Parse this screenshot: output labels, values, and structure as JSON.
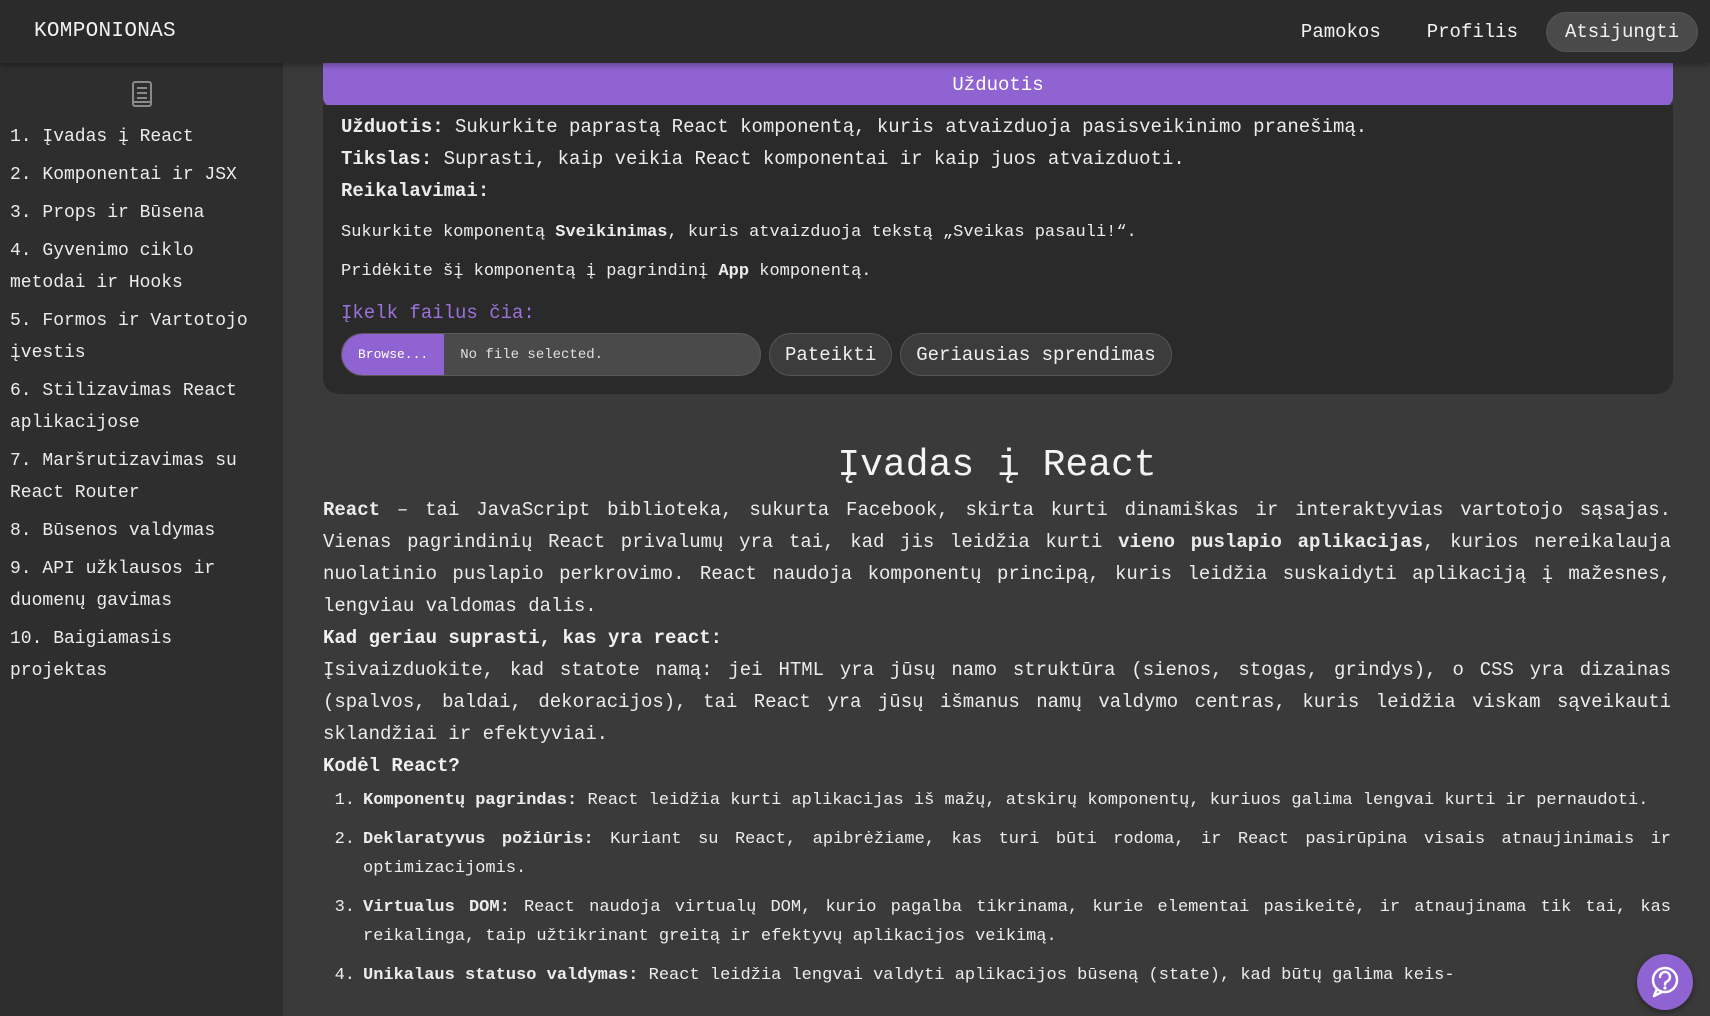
{
  "app": {
    "brand": "KOMPONIONAS",
    "nav": {
      "lessons": "Pamokos",
      "profile": "Profilis",
      "logout": "Atsijungti"
    }
  },
  "sidebar": {
    "icon": "book-icon",
    "items": [
      {
        "label": "1. Įvadas į React"
      },
      {
        "label": "2. Komponentai ir JSX"
      },
      {
        "label": "3. Props ir Būsena"
      },
      {
        "label": "4. Gyvenimo ciklo metodai ir Hooks"
      },
      {
        "label": "5. Formos ir Vartotojo įvestis"
      },
      {
        "label": "6. Stilizavimas React aplikacijose"
      },
      {
        "label": "7. Maršrutizavimas su React Router"
      },
      {
        "label": "8. Būsenos valdymas"
      },
      {
        "label": "9. API užklausos ir duomenų gavimas"
      },
      {
        "label": "10. Baigiamasis projektas"
      }
    ]
  },
  "task": {
    "header": "Užduotis",
    "task_label": "Užduotis:",
    "task_text": " Sukurkite paprastą React komponentą, kuris atvaizduoja pasisveikinimo pranešimą.",
    "goal_label": "Tikslas:",
    "goal_text": " Suprasti, kaip veikia React komponentai ir kaip juos atvaizduoti.",
    "requirements_label": "Reikalavimai:",
    "req1_a": "Sukurkite komponentą ",
    "req1_b": "Sveikinimas",
    "req1_c": ", kuris atvaizduoja tekstą „Sveikas pasauli!“.",
    "req2_a": "Pridėkite šį komponentą į pagrindinį ",
    "req2_b": "App",
    "req2_c": " komponentą.",
    "upload_label": "Įkelk failus čia:",
    "browse_label": "Browse...",
    "file_status": "No file selected.",
    "submit_label": "Pateikti",
    "best_solution_label": "Geriausias sprendimas"
  },
  "lesson": {
    "title": "Įvadas į React",
    "intro_b1": "React",
    "intro_1": " – tai JavaScript biblioteka, sukurta Facebook, skirta kurti dinamiškas ir interaktyvias vartotojo sąsajas. Vienas pagrindinių React privalumų yra tai, kad jis leidžia kurti ",
    "intro_b2": "vieno puslapio aplikacijas",
    "intro_2": ", kurios nereikalauja nuolatinio puslapio perkrovimo. React naudoja komponentų principą, kuris leidžia suskaidyti aplikaciją į mažesnes, lengviau valdomas dalis.",
    "understand_heading": "Kad geriau suprasti, kas yra react:",
    "analogy": "Įsivaizduokite, kad statote namą: jei HTML yra jūsų namo struktūra (sienos, stogas, grindys), o CSS yra dizainas (spalvos, baldai, dekoracijos), tai React yra jūsų išmanus namų valdymo centras, kuris leidžia viskam sąveikauti sklandžiai ir efektyviai.",
    "why_heading": "Kodėl React?",
    "reasons": [
      {
        "num": "1.",
        "title": "Komponentų pagrindas:",
        "text": " React leidžia kurti aplikacijas iš mažų, atskirų komponentų, kuriuos galima lengvai kurti ir pernaudoti."
      },
      {
        "num": "2.",
        "title": "Deklaratyvus požiūris:",
        "text": " Kuriant su React, apibrėžiame, kas turi būti rodoma, ir React pasirūpina visais atnaujinimais ir optimizacijomis."
      },
      {
        "num": "3.",
        "title": "Virtualus DOM:",
        "text": " React naudoja virtualų DOM, kurio pagalba tikrinama, kurie elementai pasikeitė, ir atnaujinama tik tai, kas reikalinga, taip užtikrinant greitą ir efektyvų aplikacijos veikimą."
      },
      {
        "num": "4.",
        "title": "Unikalaus statuso valdymas:",
        "text": " React leidžia lengvai valdyti aplikacijos būseną (state), kad būtų galima keis-"
      }
    ]
  },
  "help": {
    "icon": "help-question-icon"
  },
  "colors": {
    "accent": "#8f63d1",
    "topbar": "#2b2b2b",
    "sidebar": "#2e2e2e",
    "main": "#3a3a3a"
  }
}
